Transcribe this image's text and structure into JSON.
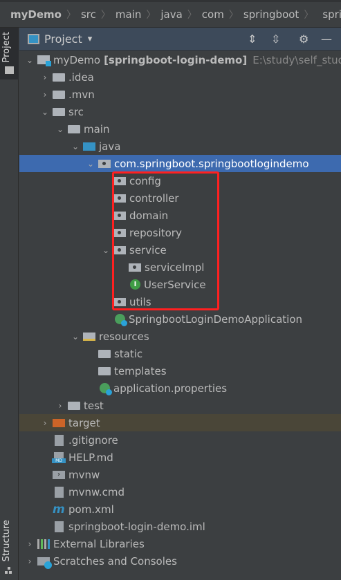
{
  "breadcrumb": [
    "myDemo",
    "src",
    "main",
    "java",
    "com",
    "springboot",
    "springboot"
  ],
  "sidebar": {
    "top": "Project",
    "bottom": "Structure"
  },
  "header": {
    "title": "Project",
    "dropdown": "▾",
    "icons": [
      "expand-all-icon",
      "collapse-all-icon",
      "gear-icon",
      "minimize-icon"
    ]
  },
  "tree": {
    "root": {
      "name": "myDemo",
      "module": "[springboot-login-demo]",
      "path": "E:\\study\\self_study\\"
    },
    "idea": ".idea",
    "mvn": ".mvn",
    "src": "src",
    "main": "main",
    "java": "java",
    "pkg": "com.springboot.springbootlogindemo",
    "config": "config",
    "controller": "controller",
    "domain": "domain",
    "repository": "repository",
    "service": "service",
    "serviceImpl": "serviceImpl",
    "UserService": "UserService",
    "utils": "utils",
    "app": "SpringbootLoginDemoApplication",
    "resources": "resources",
    "static": "static",
    "templates": "templates",
    "props": "application.properties",
    "test": "test",
    "target": "target",
    "gitignore": ".gitignore",
    "help": "HELP.md",
    "mvnw": "mvnw",
    "mvnwcmd": "mvnw.cmd",
    "pom": "pom.xml",
    "iml": "springboot-login-demo.iml",
    "ext": "External Libraries",
    "scratch": "Scratches and Consoles"
  },
  "colors": {
    "selection": "#3d6aaf",
    "highlight_box": "#ff2020",
    "excluded": "#4a4638"
  }
}
